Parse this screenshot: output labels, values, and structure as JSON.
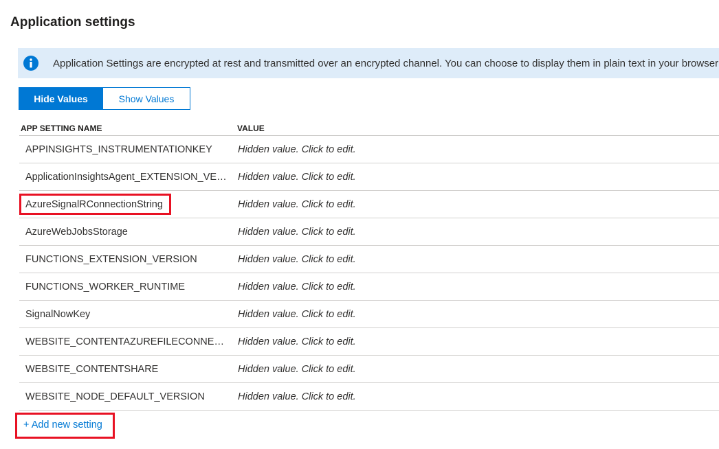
{
  "page": {
    "title": "Application settings"
  },
  "info_bar": {
    "icon": "info-icon",
    "text": "Application Settings are encrypted at rest and transmitted over an encrypted channel. You can choose to display them in plain text in your browser"
  },
  "toggle": {
    "hide_label": "Hide Values",
    "show_label": "Show Values",
    "selected": "Hide Values"
  },
  "grid": {
    "columns": [
      "APP SETTING NAME",
      "VALUE"
    ],
    "rows": [
      {
        "name": "APPINSIGHTS_INSTRUMENTATIONKEY",
        "value": "Hidden value. Click to edit."
      },
      {
        "name": "ApplicationInsightsAgent_EXTENSION_VER...",
        "value": "Hidden value. Click to edit."
      },
      {
        "name": "AzureSignalRConnectionString",
        "value": "Hidden value. Click to edit."
      },
      {
        "name": "AzureWebJobsStorage",
        "value": "Hidden value. Click to edit."
      },
      {
        "name": "FUNCTIONS_EXTENSION_VERSION",
        "value": "Hidden value. Click to edit."
      },
      {
        "name": "FUNCTIONS_WORKER_RUNTIME",
        "value": "Hidden value. Click to edit."
      },
      {
        "name": "SignalNowKey",
        "value": "Hidden value. Click to edit."
      },
      {
        "name": "WEBSITE_CONTENTAZUREFILECONNECTIO...",
        "value": "Hidden value. Click to edit."
      },
      {
        "name": "WEBSITE_CONTENTSHARE",
        "value": "Hidden value. Click to edit."
      },
      {
        "name": "WEBSITE_NODE_DEFAULT_VERSION",
        "value": "Hidden value. Click to edit."
      }
    ]
  },
  "add_setting": {
    "label": "+ Add new setting"
  },
  "colors": {
    "accent": "#0078d4",
    "info_background": "#deecf9",
    "highlight": "#e81123"
  }
}
